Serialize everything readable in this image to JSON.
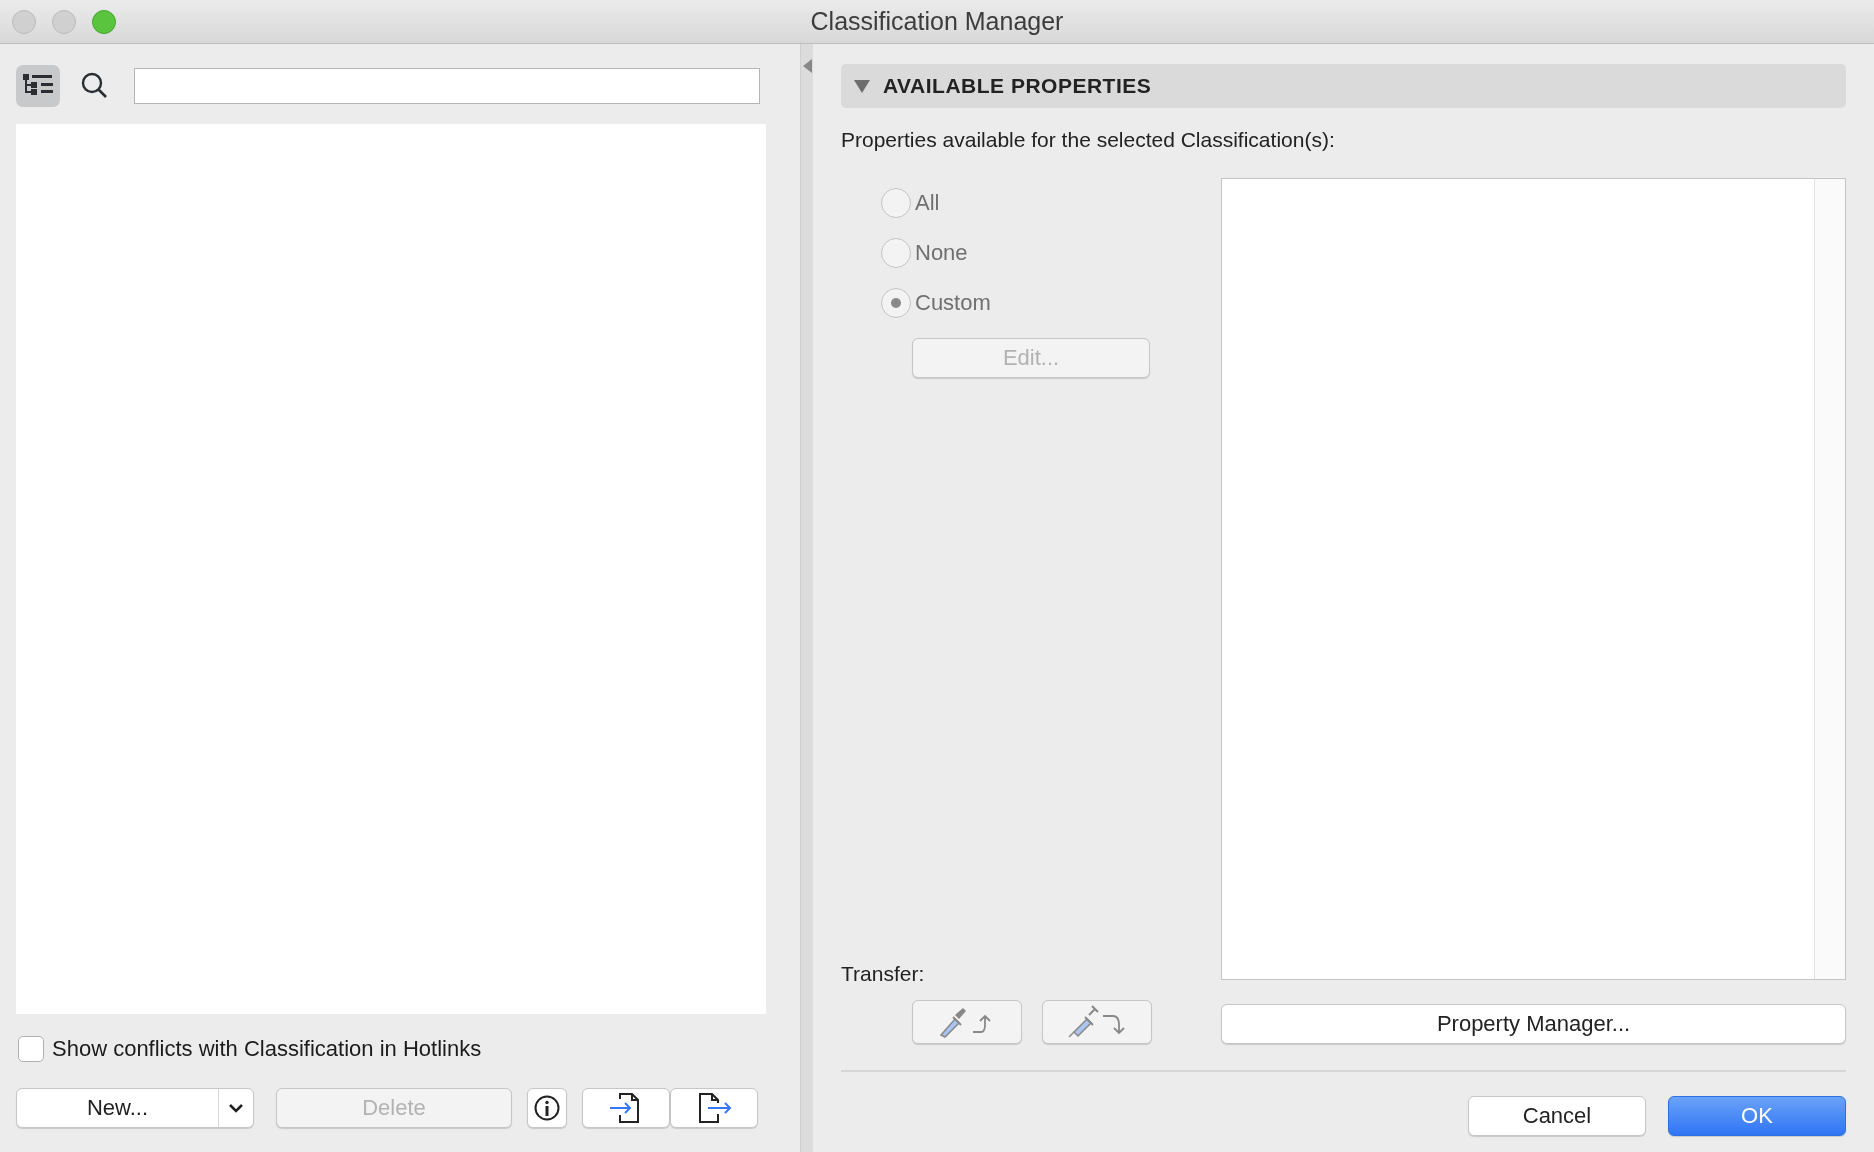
{
  "window": {
    "title": "Classification Manager"
  },
  "left_panel": {
    "show_conflicts": {
      "label": "Show conflicts with Classification in Hotlinks",
      "checked": false
    },
    "buttons": {
      "new": {
        "label": "New..."
      },
      "delete": {
        "label": "Delete",
        "disabled": true
      }
    }
  },
  "right_panel": {
    "section": {
      "title": "AVAILABLE PROPERTIES",
      "expanded": true
    },
    "description": "Properties available for the selected Classification(s):",
    "radios": [
      {
        "label": "All",
        "selected": false,
        "disabled": true
      },
      {
        "label": "None",
        "selected": false,
        "disabled": true
      },
      {
        "label": "Custom",
        "selected": true,
        "disabled": true
      }
    ],
    "edit_button": {
      "label": "Edit...",
      "disabled": true
    },
    "transfer_label": "Transfer:",
    "property_manager_button": {
      "label": "Property Manager..."
    }
  },
  "footer": {
    "buttons": [
      {
        "label": "Cancel",
        "kind": "secondary"
      },
      {
        "label": "OK",
        "kind": "primary"
      }
    ]
  }
}
